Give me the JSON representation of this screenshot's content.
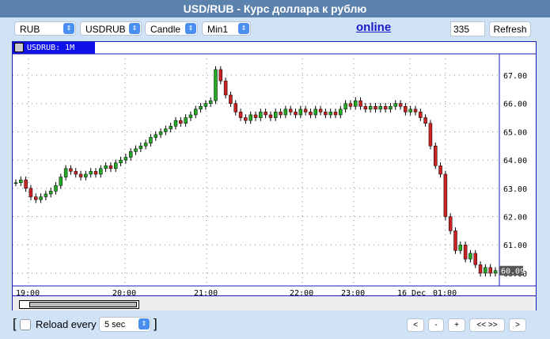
{
  "title": "USD/RUB - Курс доллара к рублю",
  "toolbar": {
    "currency": "RUB",
    "symbol": "USDRUB",
    "chart_type": "Candle",
    "interval": "Min1",
    "online_link": "online",
    "count_value": "335",
    "refresh_label": "Refresh"
  },
  "chart": {
    "header": "USDRUB: 1M",
    "last_price": "60.09",
    "y_ticks": [
      "67.00",
      "66.00",
      "65.00",
      "64.00",
      "63.00",
      "62.00",
      "61.00",
      "60.00"
    ],
    "x_ticks": [
      "19:00",
      "20:00",
      "21:00",
      "22:00",
      "23:00",
      "16 Dec",
      "01:00"
    ],
    "colors": {
      "up": "#22aa22",
      "down": "#cc2222",
      "wick": "#000000"
    },
    "closes": [
      63.2,
      63.3,
      63.0,
      62.7,
      62.6,
      62.7,
      62.8,
      62.9,
      63.1,
      63.4,
      63.7,
      63.6,
      63.5,
      63.4,
      63.5,
      63.6,
      63.5,
      63.7,
      63.8,
      63.7,
      63.9,
      64.0,
      64.1,
      64.3,
      64.4,
      64.5,
      64.6,
      64.8,
      64.9,
      65.0,
      65.1,
      65.2,
      65.4,
      65.3,
      65.5,
      65.6,
      65.8,
      65.9,
      66.0,
      66.1,
      67.2,
      66.8,
      66.3,
      66.0,
      65.7,
      65.5,
      65.4,
      65.6,
      65.5,
      65.7,
      65.6,
      65.5,
      65.7,
      65.6,
      65.8,
      65.7,
      65.6,
      65.8,
      65.7,
      65.6,
      65.8,
      65.7,
      65.6,
      65.7,
      65.6,
      65.8,
      66.0,
      65.9,
      66.1,
      65.9,
      65.8,
      65.9,
      65.8,
      65.9,
      65.8,
      65.9,
      66.0,
      65.9,
      65.7,
      65.8,
      65.7,
      65.5,
      65.3,
      64.5,
      63.8,
      63.5,
      62.0,
      61.5,
      60.8,
      61.0,
      60.5,
      60.7,
      60.3,
      60.0,
      60.2,
      60.0,
      60.09
    ]
  },
  "footer": {
    "reload_label": "Reload every",
    "reload_interval": "5 sec",
    "bracket_open": "[",
    "bracket_close": "]",
    "nav": [
      "<",
      "-",
      "+",
      "<< >>",
      ">"
    ]
  }
}
